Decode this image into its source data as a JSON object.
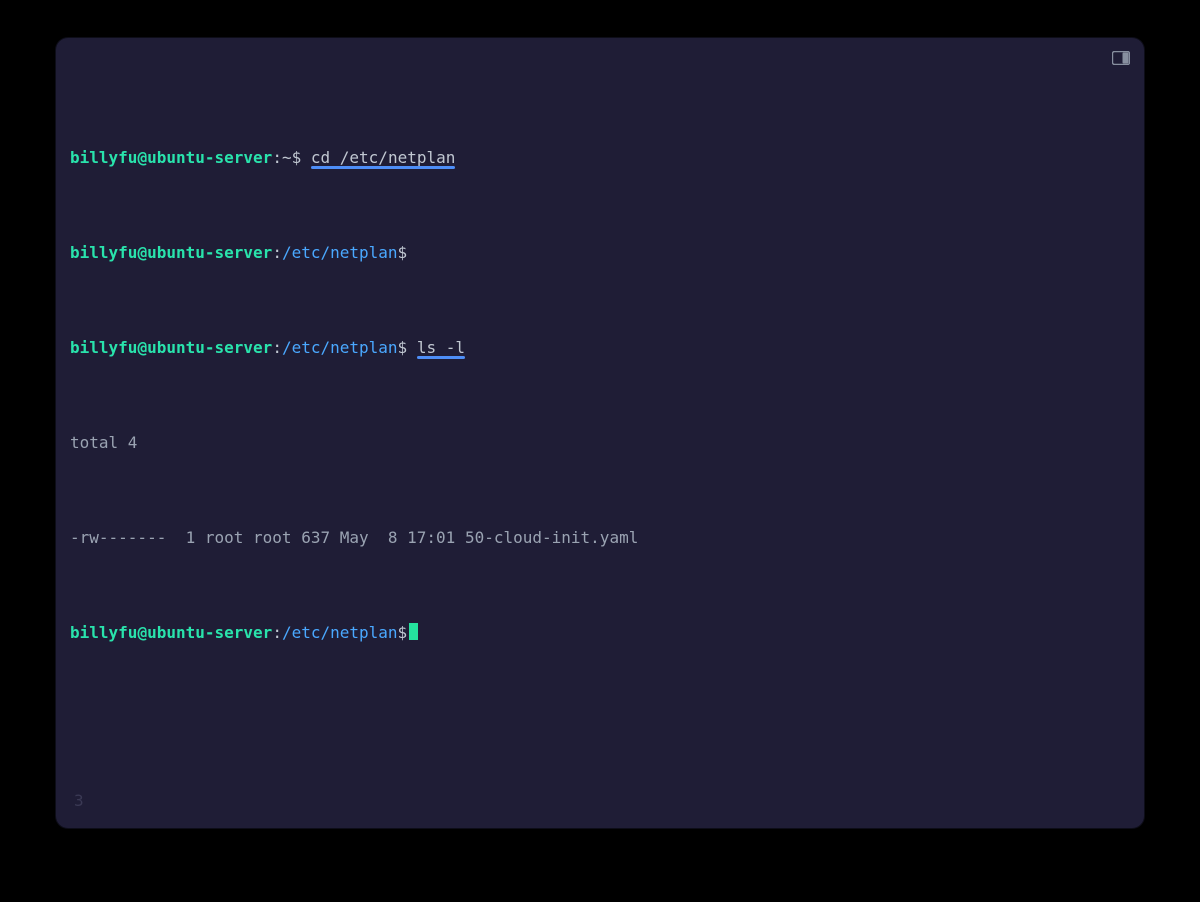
{
  "window": {
    "icon": "panel-split-icon"
  },
  "prompt": {
    "user": "billyfu",
    "at": "@",
    "host": "ubuntu-server",
    "colon": ":",
    "home_indicator": "~",
    "netplan_path": "/etc/netplan",
    "dollar": "$"
  },
  "lines": {
    "cmd1_lead_space": " ",
    "cmd1": "cd /etc/netplan",
    "cmd2_lead_space": " ",
    "cmd2": "ls -l",
    "out_total": "total 4",
    "out_listing": "-rw-------  1 root root 637 May  8 17:01 50-cloud-init.yaml"
  },
  "footer": {
    "hint": "3"
  },
  "colors": {
    "bg": "#1f1d36",
    "user_host": "#29e3ac",
    "path": "#4aa8ff",
    "command_text": "#c0c7d1",
    "output_text": "#9aa3b2",
    "underline": "#4e8ef7",
    "cursor": "#25e29e"
  }
}
